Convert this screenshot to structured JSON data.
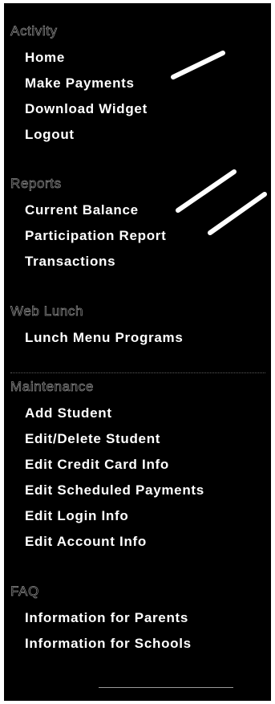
{
  "nav": {
    "activity": {
      "heading": "Activity",
      "items": [
        "Home",
        "Make Payments",
        "Download Widget",
        "Logout"
      ]
    },
    "reports": {
      "heading": "Reports",
      "items": [
        "Current Balance",
        "Participation Report",
        "Transactions"
      ]
    },
    "web_lunch": {
      "heading": "Web Lunch",
      "items": [
        "Lunch Menu Programs"
      ]
    },
    "maintenance": {
      "heading": "Maintenance",
      "items": [
        "Add Student",
        "Edit/Delete Student",
        "Edit Credit Card Info",
        "Edit Scheduled Payments",
        "Edit Login Info",
        "Edit Account Info"
      ]
    },
    "faq": {
      "heading": "FAQ",
      "items": [
        "Information for Parents",
        "Information for Schools"
      ]
    }
  },
  "colors": {
    "panel_background": "#000000",
    "item_text": "#ffffff",
    "heading_outline": "#8f8f8f",
    "annotation_marks": "#ffffff"
  }
}
